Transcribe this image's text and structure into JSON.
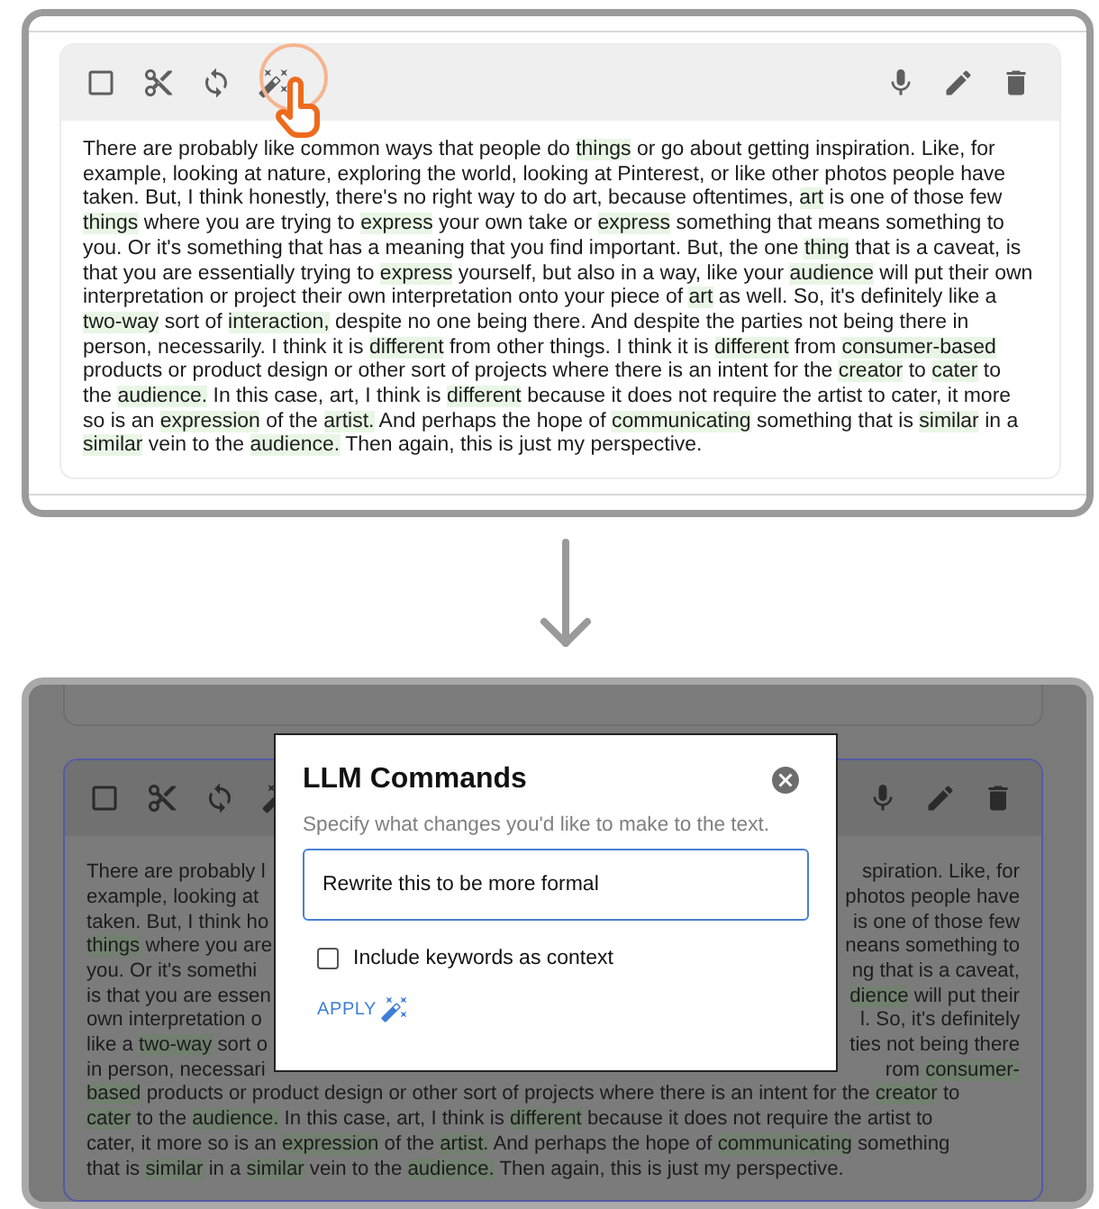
{
  "before": {
    "toolbar": {
      "left_tools": [
        {
          "kind": "select"
        },
        {
          "kind": "cut"
        },
        {
          "kind": "refresh"
        },
        {
          "kind": "magic"
        }
      ],
      "right_tools": [
        {
          "kind": "mic"
        },
        {
          "kind": "edit"
        },
        {
          "kind": "delete"
        }
      ]
    },
    "paragraph": [
      {
        "text": "There are probably like common ways that people do ",
        "highlighted": false
      },
      {
        "text": "things",
        "highlighted": true
      },
      {
        "text": " or go about getting inspiration. Like, for example, looking at nature, exploring the world, looking at Pinterest, or like other photos people have taken. But, I think honestly, there's no right way to do art, because oftentimes, ",
        "highlighted": false
      },
      {
        "text": "art",
        "highlighted": true
      },
      {
        "text": " is one of those few ",
        "highlighted": false
      },
      {
        "text": "things",
        "highlighted": true
      },
      {
        "text": " where you are trying to ",
        "highlighted": false
      },
      {
        "text": "express",
        "highlighted": true
      },
      {
        "text": " your own take or ",
        "highlighted": false
      },
      {
        "text": "express",
        "highlighted": true
      },
      {
        "text": " something that means something to you. Or it's something that has a meaning that you find important. But, the one ",
        "highlighted": false
      },
      {
        "text": "thing",
        "highlighted": true
      },
      {
        "text": " that is a caveat, is that you are essentially trying to ",
        "highlighted": false
      },
      {
        "text": "express",
        "highlighted": true
      },
      {
        "text": " yourself, but also in a way, like your ",
        "highlighted": false
      },
      {
        "text": "audience",
        "highlighted": true
      },
      {
        "text": " will put their own interpretation or project their own interpretation onto your piece of ",
        "highlighted": false
      },
      {
        "text": "art",
        "highlighted": true
      },
      {
        "text": " as well. So, it's definitely like a ",
        "highlighted": false
      },
      {
        "text": "two-way",
        "highlighted": true
      },
      {
        "text": " sort of ",
        "highlighted": false
      },
      {
        "text": "interaction,",
        "highlighted": true
      },
      {
        "text": " despite no one being there. And despite the parties not being there in person, necessarily. I think it is ",
        "highlighted": false
      },
      {
        "text": "different",
        "highlighted": true
      },
      {
        "text": " from other things. I think it is ",
        "highlighted": false
      },
      {
        "text": "different",
        "highlighted": true
      },
      {
        "text": " from ",
        "highlighted": false
      },
      {
        "text": "consumer-based",
        "highlighted": true
      },
      {
        "text": " products or product design or other sort of projects where there is an intent for the ",
        "highlighted": false
      },
      {
        "text": "creator",
        "highlighted": true
      },
      {
        "text": " to ",
        "highlighted": false
      },
      {
        "text": "cater",
        "highlighted": true
      },
      {
        "text": " to the ",
        "highlighted": false
      },
      {
        "text": "audience.",
        "highlighted": true
      },
      {
        "text": " In this case, art, I think is ",
        "highlighted": false
      },
      {
        "text": "different",
        "highlighted": true
      },
      {
        "text": " because it does not require the artist to cater, it more so is an ",
        "highlighted": false
      },
      {
        "text": "expression",
        "highlighted": true
      },
      {
        "text": " of the ",
        "highlighted": false
      },
      {
        "text": "artist.",
        "highlighted": true
      },
      {
        "text": " And perhaps the hope of ",
        "highlighted": false
      },
      {
        "text": "communicating",
        "highlighted": true
      },
      {
        "text": " something that is ",
        "highlighted": false
      },
      {
        "text": "similar",
        "highlighted": true
      },
      {
        "text": " in a ",
        "highlighted": false
      },
      {
        "text": "similar",
        "highlighted": true
      },
      {
        "text": " vein to the ",
        "highlighted": false
      },
      {
        "text": "audience.",
        "highlighted": true
      },
      {
        "text": " Then again, this is just my perspective.",
        "highlighted": false
      }
    ]
  },
  "after": {
    "toolbar": {
      "left_tools": [
        {
          "kind": "select"
        },
        {
          "kind": "cut"
        },
        {
          "kind": "refresh"
        },
        {
          "kind": "magic"
        }
      ],
      "right_tools": [
        {
          "kind": "mic"
        },
        {
          "kind": "edit"
        },
        {
          "kind": "delete"
        }
      ]
    },
    "lines": [
      {
        "kind": "split",
        "left": [
          {
            "text": "There are probably l",
            "highlighted": false
          }
        ],
        "right": [
          {
            "text": "spiration. Like, for",
            "highlighted": false
          }
        ]
      },
      {
        "kind": "split",
        "left": [
          {
            "text": "example, looking at",
            "highlighted": false
          }
        ],
        "right": [
          {
            "text": "photos people have",
            "highlighted": false
          }
        ]
      },
      {
        "kind": "split",
        "left": [
          {
            "text": "taken. But, I think ho",
            "highlighted": false
          }
        ],
        "right": [
          {
            "text": "is one of those few",
            "highlighted": false
          }
        ]
      },
      {
        "kind": "split",
        "left": [
          {
            "text": "things",
            "highlighted": true
          },
          {
            "text": " where you are",
            "highlighted": false
          }
        ],
        "right": [
          {
            "text": "neans something to",
            "highlighted": false
          }
        ]
      },
      {
        "kind": "split",
        "left": [
          {
            "text": "you. Or it's somethi",
            "highlighted": false
          }
        ],
        "right": [
          {
            "text": "ng that is a caveat,",
            "highlighted": false
          }
        ]
      },
      {
        "kind": "split",
        "left": [
          {
            "text": "is that you are essen",
            "highlighted": false
          }
        ],
        "right": [
          {
            "text": "dience",
            "highlighted": true
          },
          {
            "text": " will put their",
            "highlighted": false
          }
        ]
      },
      {
        "kind": "split",
        "left": [
          {
            "text": "own interpretation o",
            "highlighted": false
          }
        ],
        "right": [
          {
            "text": "l. So, it's definitely",
            "highlighted": false
          }
        ]
      },
      {
        "kind": "split",
        "left": [
          {
            "text": "like a ",
            "highlighted": false
          },
          {
            "text": "two-way",
            "highlighted": true
          },
          {
            "text": " sort o",
            "highlighted": false
          }
        ],
        "right": [
          {
            "text": "ties not being there",
            "highlighted": false
          }
        ]
      },
      {
        "kind": "split",
        "left": [
          {
            "text": "in person, necessari",
            "highlighted": false
          }
        ],
        "right": [
          {
            "text": "rom ",
            "highlighted": false
          },
          {
            "text": "consumer-",
            "highlighted": true
          }
        ]
      },
      {
        "kind": "full",
        "left": [
          {
            "text": "based",
            "highlighted": true
          },
          {
            "text": " products or product design or other sort of projects where there is an intent for the ",
            "highlighted": false
          },
          {
            "text": "creator",
            "highlighted": true
          },
          {
            "text": " to",
            "highlighted": false
          }
        ]
      },
      {
        "kind": "full",
        "left": [
          {
            "text": "cater",
            "highlighted": true
          },
          {
            "text": " to the ",
            "highlighted": false
          },
          {
            "text": "audience.",
            "highlighted": true
          },
          {
            "text": " In this case, art, I think is ",
            "highlighted": false
          },
          {
            "text": "different",
            "highlighted": true
          },
          {
            "text": " because it does not require the artist to",
            "highlighted": false
          }
        ]
      },
      {
        "kind": "full",
        "left": [
          {
            "text": "cater, it more so is an ",
            "highlighted": false
          },
          {
            "text": "expression",
            "highlighted": true
          },
          {
            "text": " of the ",
            "highlighted": false
          },
          {
            "text": "artist.",
            "highlighted": true
          },
          {
            "text": " And perhaps the hope of ",
            "highlighted": false
          },
          {
            "text": "communicating",
            "highlighted": true
          },
          {
            "text": " something",
            "highlighted": false
          }
        ]
      },
      {
        "kind": "full",
        "left": [
          {
            "text": "that is ",
            "highlighted": false
          },
          {
            "text": "similar",
            "highlighted": true
          },
          {
            "text": " in a ",
            "highlighted": false
          },
          {
            "text": "similar",
            "highlighted": true
          },
          {
            "text": " vein to the ",
            "highlighted": false
          },
          {
            "text": "audience.",
            "highlighted": true
          },
          {
            "text": " Then again, this is just my perspective.",
            "highlighted": false
          }
        ]
      }
    ],
    "dialog": {
      "title": "LLM Commands",
      "subtitle": "Specify what changes you'd like to make to the text.",
      "input": {
        "value": "Rewrite this to be more formal"
      },
      "checkbox": {
        "label": "Include keywords as context",
        "checked": false
      },
      "apply_button": {
        "label": "APPLY"
      }
    }
  }
}
